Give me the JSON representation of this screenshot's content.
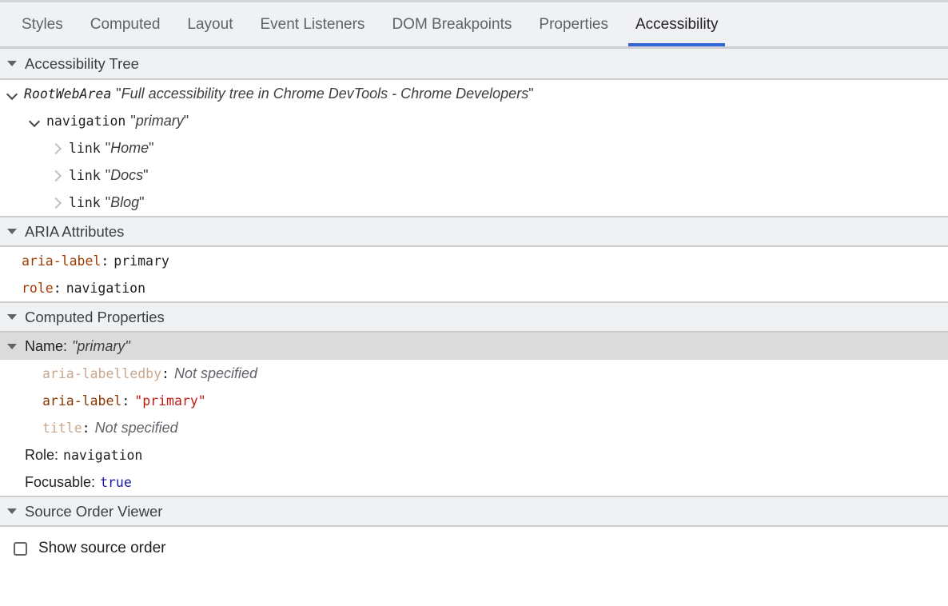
{
  "tabs": [
    {
      "label": "Styles",
      "active": false
    },
    {
      "label": "Computed",
      "active": false
    },
    {
      "label": "Layout",
      "active": false
    },
    {
      "label": "Event Listeners",
      "active": false
    },
    {
      "label": "DOM Breakpoints",
      "active": false
    },
    {
      "label": "Properties",
      "active": false
    },
    {
      "label": "Accessibility",
      "active": true
    }
  ],
  "sections": {
    "accessibility_tree": {
      "title": "Accessibility Tree",
      "expanded": true
    },
    "aria_attributes": {
      "title": "ARIA Attributes",
      "expanded": true
    },
    "computed_properties": {
      "title": "Computed Properties",
      "expanded": true
    },
    "source_order_viewer": {
      "title": "Source Order Viewer",
      "expanded": true
    }
  },
  "accessibility_tree": {
    "nodes": [
      {
        "role": "RootWebArea",
        "name": "Full accessibility tree in Chrome DevTools - Chrome Developers",
        "state": "expanded",
        "depth": 0,
        "name_pad": ""
      },
      {
        "role": "navigation",
        "name": "primary",
        "state": "expanded",
        "depth": 1,
        "name_pad": ""
      },
      {
        "role": "link",
        "name": "Home",
        "state": "collapsed",
        "depth": 2,
        "name_pad": " "
      },
      {
        "role": "link",
        "name": "Docs",
        "state": "collapsed",
        "depth": 2,
        "name_pad": " "
      },
      {
        "role": "link",
        "name": "Blog",
        "state": "collapsed",
        "depth": 2,
        "name_pad": " "
      }
    ]
  },
  "aria_attributes": {
    "items": [
      {
        "name": "aria-label",
        "separator": ":",
        "value": "primary"
      },
      {
        "name": "role",
        "separator": ":",
        "value": "navigation"
      }
    ]
  },
  "computed_properties": {
    "name_row": {
      "label": "Name:",
      "value": "\"primary\"",
      "selected": true,
      "expanded": true
    },
    "name_sources": [
      {
        "name": "aria-labelledby",
        "separator": ":",
        "value": "Not specified",
        "value_kind": "unset",
        "dimmed": true
      },
      {
        "name": "aria-label",
        "separator": ":",
        "value": "\"primary\"",
        "value_kind": "string",
        "dimmed": false
      },
      {
        "name": "title",
        "separator": ":",
        "value": "Not specified",
        "value_kind": "unset",
        "dimmed": true
      }
    ],
    "properties": [
      {
        "label": "Role:",
        "value": "navigation",
        "value_kind": "plain"
      },
      {
        "label": "Focusable:",
        "value": "true",
        "value_kind": "bool"
      }
    ]
  },
  "source_order_viewer": {
    "checkbox_label": "Show source order",
    "checked": false
  },
  "colors": {
    "accent": "#3367d6",
    "header_bg": "#f0f1f3",
    "selected_row": "#dbdbdb",
    "attr_name": "#a23b00",
    "attr_name_dim": "#c9a78c",
    "string_value": "#c41a16",
    "bool_value": "#1a1aa6"
  }
}
